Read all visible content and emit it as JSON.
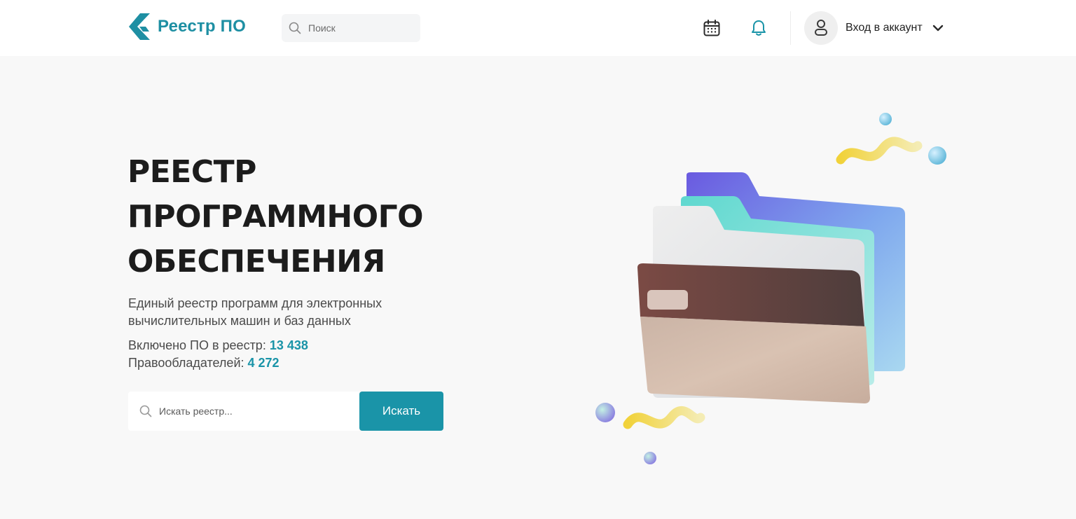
{
  "header": {
    "logo_text": "Реестр ПО",
    "search_placeholder": "Поиск",
    "account_label": "Вход в аккаунт"
  },
  "hero": {
    "title": "РЕЕСТР\nПРОГРАММНОГО\nОБЕСПЕЧЕНИЯ",
    "subtitle": "Единый реестр программ для электронных вычислительных машин и баз данных",
    "stats": [
      {
        "label": "Включено ПО в реестр: ",
        "value": "13 438"
      },
      {
        "label": "Правообладателей: ",
        "value": "4 272"
      }
    ],
    "search_placeholder": "Искать реестр...",
    "search_button": "Искать"
  },
  "colors": {
    "accent": "#1a94a8",
    "title": "#1c1c1c",
    "background": "#f8f8f8"
  },
  "icons": [
    "logo-icon",
    "search-icon",
    "calendar-icon",
    "bell-icon",
    "user-icon",
    "chevron-down-icon",
    "folder-illustration"
  ]
}
